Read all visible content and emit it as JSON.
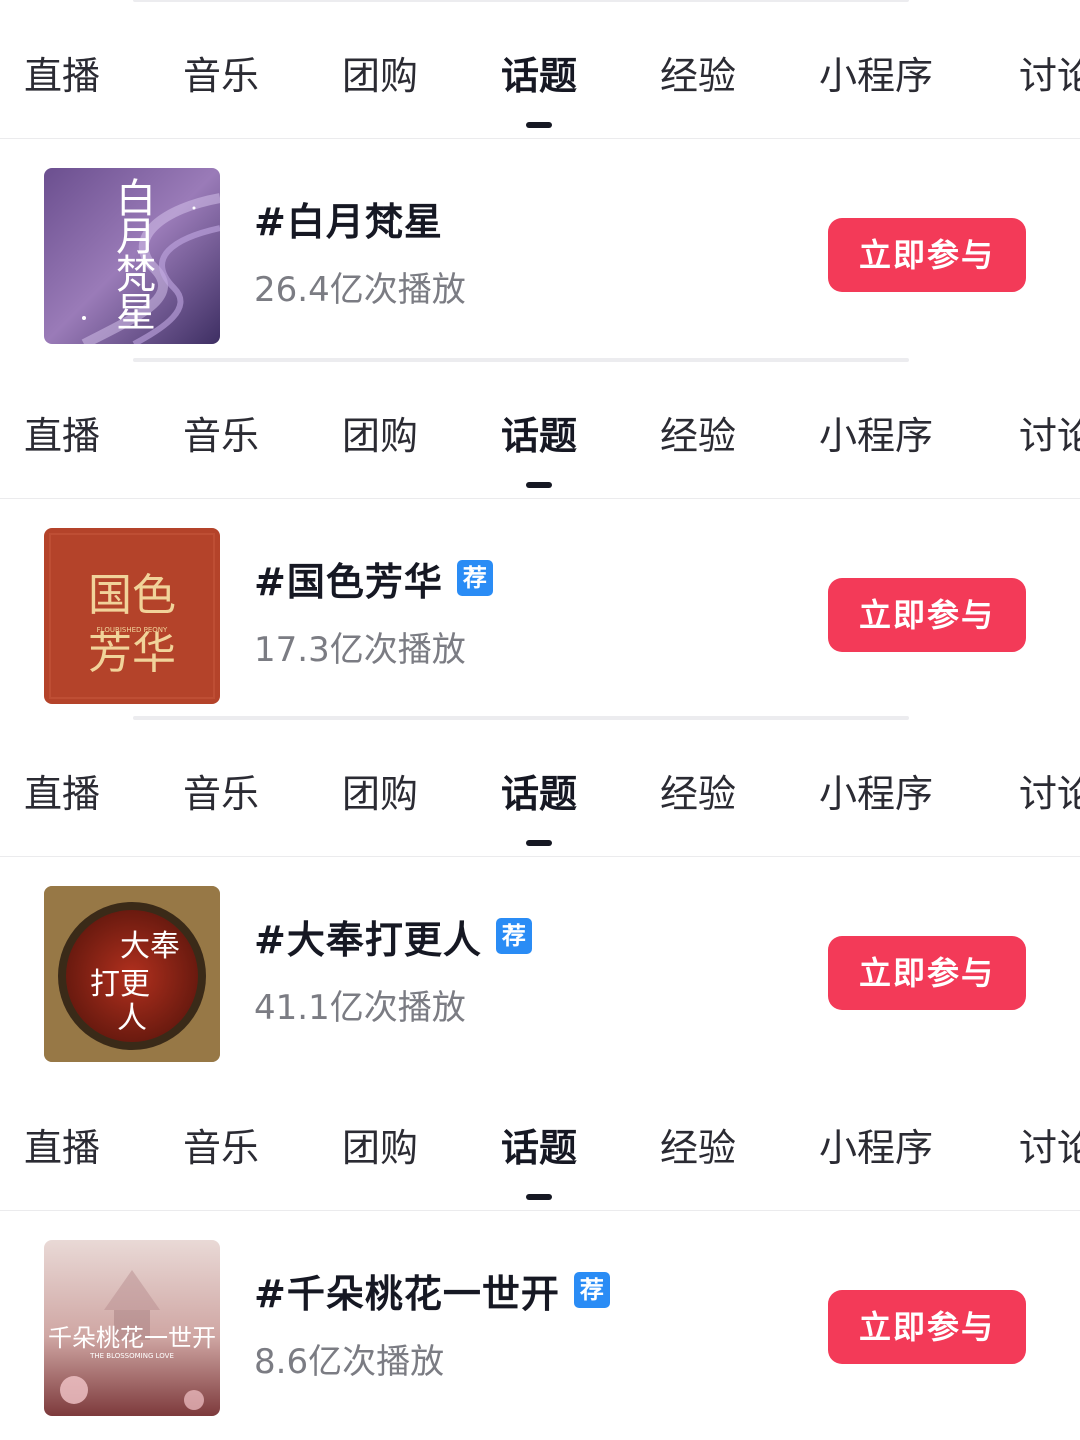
{
  "tabs": [
    "直播",
    "音乐",
    "团购",
    "话题",
    "经验",
    "小程序",
    "讨论"
  ],
  "active_tab": "话题",
  "topics": [
    {
      "title": "#白月梵星",
      "recommended": false,
      "plays": "26.4亿次播放",
      "join_label": "立即参与",
      "cover_text": "白月梵星",
      "cover_subtext": ""
    },
    {
      "title": "#国色芳华",
      "recommended": true,
      "badge": "荐",
      "plays": "17.3亿次播放",
      "join_label": "立即参与",
      "cover_text": "国色芳华",
      "cover_subtext": "FLOURISHED PEONY"
    },
    {
      "title": "#大奉打更人",
      "recommended": true,
      "badge": "荐",
      "plays": "41.1亿次播放",
      "join_label": "立即参与",
      "cover_text": "大奉打更人",
      "cover_subtext": ""
    },
    {
      "title": "#千朵桃花一世开",
      "recommended": true,
      "badge": "荐",
      "plays": "8.6亿次播放",
      "join_label": "立即参与",
      "cover_text": "千朵桃花一世开",
      "cover_subtext": "THE BLOSSOMING LOVE"
    }
  ],
  "colors": {
    "join_button": "#f33a58",
    "badge": "#2a8cf5",
    "active_tab_indicator": "#161823"
  }
}
